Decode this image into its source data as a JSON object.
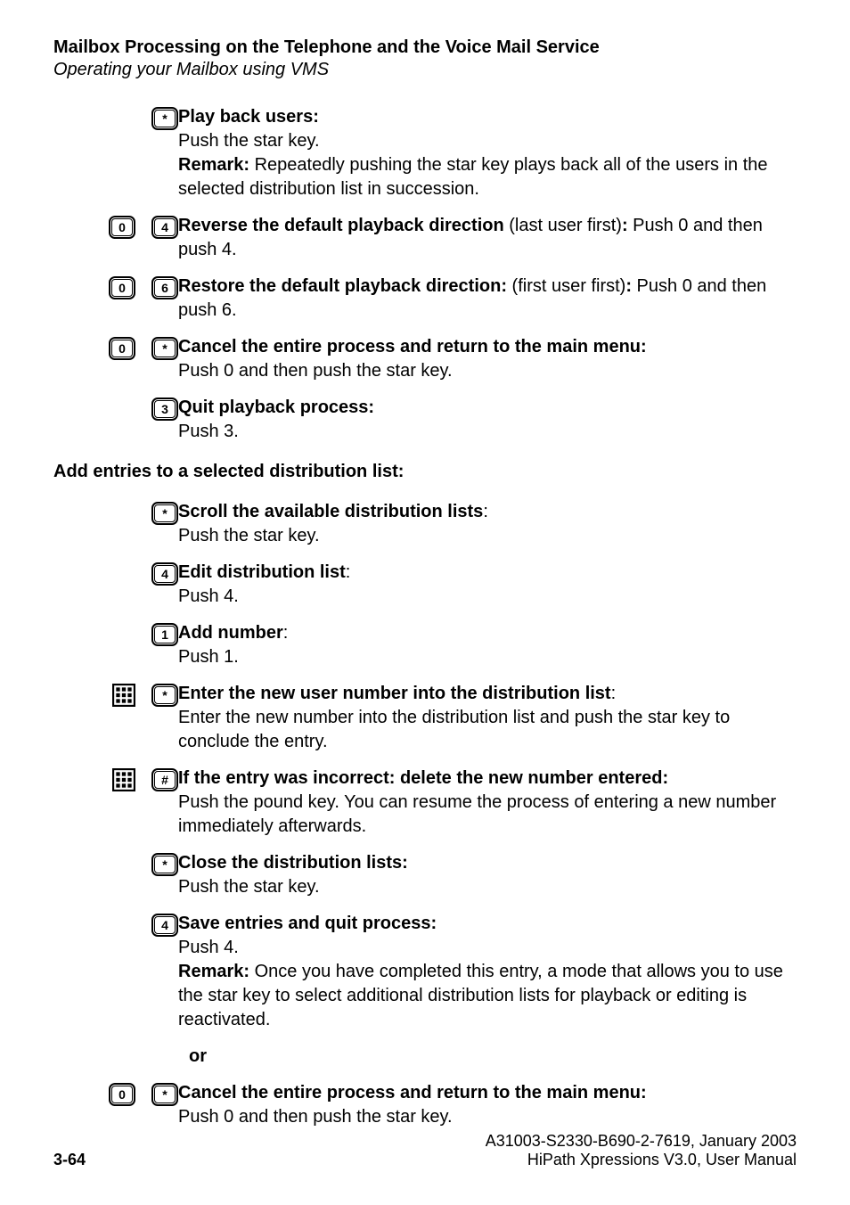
{
  "header": {
    "title": "Mailbox Processing on the Telephone and the Voice Mail Service",
    "subtitle": "Operating your Mailbox using VMS"
  },
  "playback": {
    "play_users": {
      "key": "*",
      "title": "Play back users:",
      "line1": "Push the star key.",
      "remark_label": "Remark:",
      "remark_body": " Repeatedly pushing the star key plays back all of the users in the selected distribution list in succession."
    },
    "reverse": {
      "key1": "0",
      "key2": "4",
      "title": "Reverse the default playback direction",
      "paren": " (last user first)",
      "colon": ":",
      "body": " Push 0 and then push 4."
    },
    "restore": {
      "key1": "0",
      "key2": "6",
      "title": "Restore the default playback direction:",
      "paren": " (first user first)",
      "colon": ":",
      "body": " Push 0 and then push 6."
    },
    "cancel": {
      "key1": "0",
      "key2": "*",
      "title": "Cancel the entire process and return to the main menu:",
      "body": "Push 0 and then push the star key."
    },
    "quit": {
      "key": "3",
      "title": "Quit playback process:",
      "body": "Push 3."
    }
  },
  "section_add_title": "Add entries to a selected distribution list:",
  "add": {
    "scroll": {
      "key": "*",
      "title": "Scroll the available distribution lists",
      "colon": ":",
      "body": "Push the star key."
    },
    "edit": {
      "key": "4",
      "title": "Edit distribution list",
      "colon": ":",
      "body": "Push 4."
    },
    "addnum": {
      "key": "1",
      "title": "Add number",
      "colon": ":",
      "body": "Push 1."
    },
    "enter": {
      "key": "*",
      "title": "Enter the new user number into the distribution list",
      "colon": ":",
      "body": "Enter the new number into the distribution list and push the star key to conclude the entry."
    },
    "incorrect": {
      "key": "#",
      "title": "If the entry was incorrect: delete the new number entered:",
      "body": "Push the pound key. You can resume the process of entering a new number immediately afterwards."
    },
    "close": {
      "key": "*",
      "title": "Close the distribution lists:",
      "body": "Push the star key."
    },
    "save": {
      "key": "4",
      "title": "Save entries and quit process:",
      "body1": "Push 4.",
      "remark_label": "Remark:",
      "remark_body": " Once you have completed this entry, a mode that allows you to use the star key to select additional distribution lists for playback or editing is reactivated."
    },
    "or": "or",
    "cancel": {
      "key1": "0",
      "key2": "*",
      "title": "Cancel the entire process and return to the main menu:",
      "body": "Push 0 and then push the star key."
    }
  },
  "footer": {
    "page": "3-64",
    "doc": "A31003-S2330-B690-2-7619, January 2003",
    "manual": "HiPath Xpressions V3.0, User Manual"
  }
}
